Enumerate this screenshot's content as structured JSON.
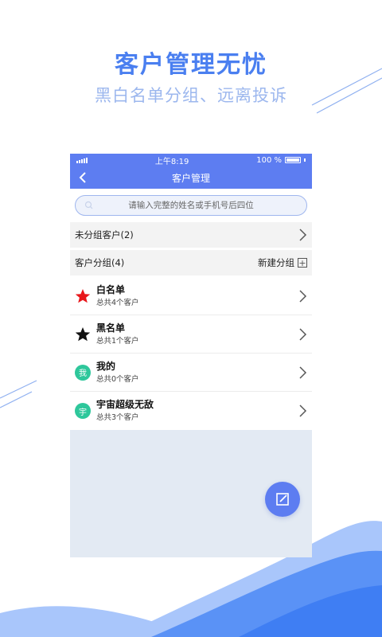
{
  "promo": {
    "title": "客户管理无忧",
    "subtitle": "黑白名单分组、远离投诉"
  },
  "status_bar": {
    "time": "上午8:19",
    "battery": "100 %"
  },
  "nav": {
    "title": "客户管理",
    "back_icon": "chevron-left-icon"
  },
  "search": {
    "placeholder": "请输入完整的姓名或手机号后四位",
    "value": ""
  },
  "ungrouped": {
    "label": "未分组客户(2)"
  },
  "groups_header": {
    "label": "客户分组(4)",
    "new_group_label": "新建分组"
  },
  "groups": [
    {
      "name": "白名单",
      "count": "总共4个客户",
      "icon": "red-star-icon"
    },
    {
      "name": "黑名单",
      "count": "总共1个客户",
      "icon": "black-star-icon"
    },
    {
      "name": "我的",
      "count": "总共0个客户",
      "avatar": "我"
    },
    {
      "name": "宇宙超级无敌",
      "count": "总共3个客户",
      "avatar": "宇"
    }
  ],
  "colors": {
    "accent": "#5d7df1",
    "promo_title": "#4a7ff0",
    "avatar_green": "#2ec79b",
    "star_red": "#e8171b"
  }
}
